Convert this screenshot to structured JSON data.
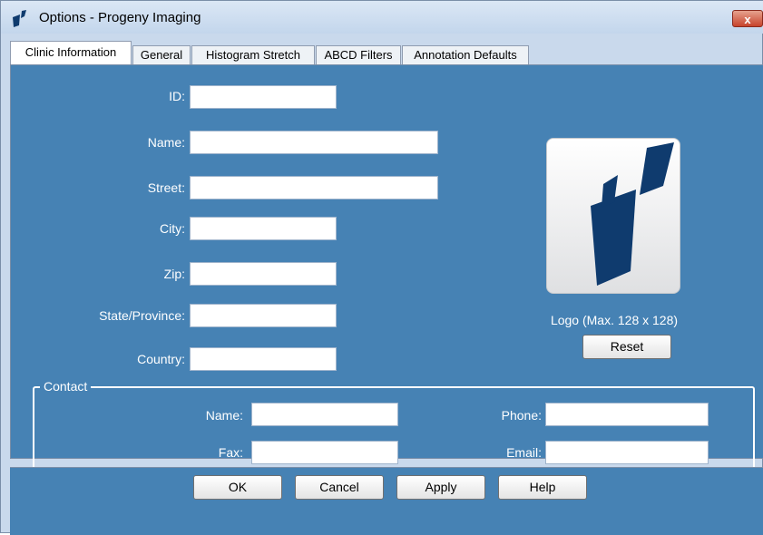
{
  "window": {
    "title": "Options - Progeny Imaging",
    "close_label": "x"
  },
  "tabs": [
    {
      "label": "Clinic Information",
      "active": true
    },
    {
      "label": "General",
      "active": false
    },
    {
      "label": "Histogram Stretch",
      "active": false
    },
    {
      "label": "ABCD Filters",
      "active": false
    },
    {
      "label": "Annotation Defaults",
      "active": false
    }
  ],
  "clinic": {
    "fields": [
      {
        "label": "ID:",
        "value": ""
      },
      {
        "label": "Name:",
        "value": ""
      },
      {
        "label": "Street:",
        "value": ""
      },
      {
        "label": "City:",
        "value": ""
      },
      {
        "label": "Zip:",
        "value": ""
      },
      {
        "label": "State/Province:",
        "value": ""
      },
      {
        "label": "Country:",
        "value": ""
      }
    ]
  },
  "logo": {
    "caption": "Logo (Max. 128 x 128)",
    "reset_label": "Reset",
    "icon": "progeny-logo-icon"
  },
  "contact": {
    "legend": "Contact",
    "fields": [
      {
        "label": "Name:",
        "value": ""
      },
      {
        "label": "Fax:",
        "value": ""
      },
      {
        "label": "Phone:",
        "value": ""
      },
      {
        "label": "Email:",
        "value": ""
      }
    ]
  },
  "buttons": {
    "ok": "OK",
    "cancel": "Cancel",
    "apply": "Apply",
    "help": "Help"
  },
  "colors": {
    "panel": "#4682b4",
    "logo_blue": "#0f3b6e"
  }
}
